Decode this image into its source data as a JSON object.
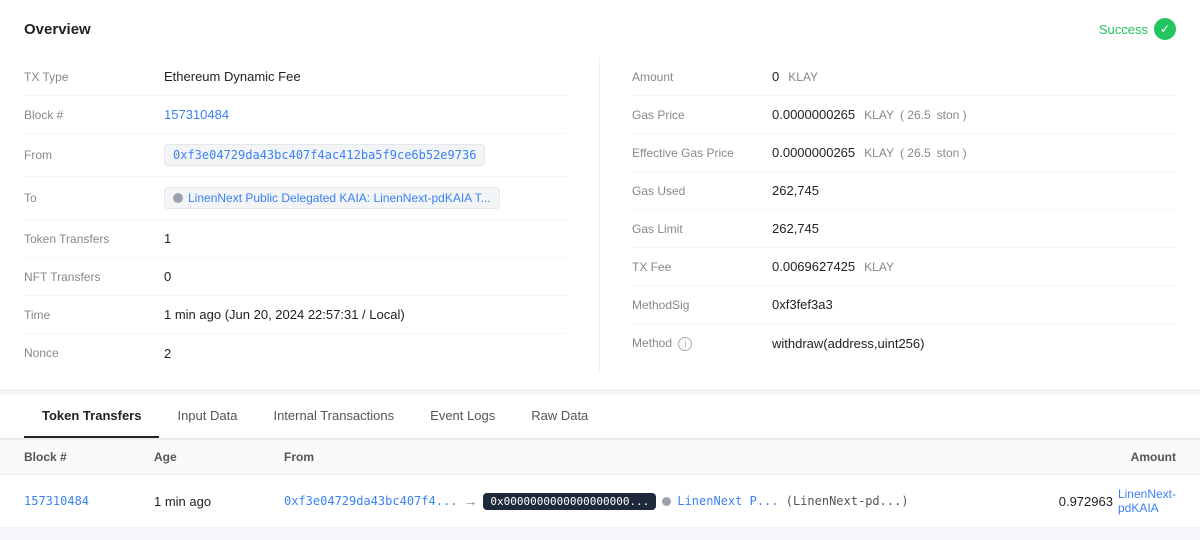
{
  "overview": {
    "title": "Overview",
    "status": "Success",
    "left": {
      "fields": [
        {
          "id": "tx-type",
          "label": "TX Type",
          "value": "Ethereum Dynamic Fee",
          "type": "text"
        },
        {
          "id": "block",
          "label": "Block #",
          "value": "157310484",
          "type": "link"
        },
        {
          "id": "from",
          "label": "From",
          "value": "0xf3e04729da43bc407f4ac412ba5f9ce6b52e9736",
          "type": "address"
        },
        {
          "id": "to",
          "label": "To",
          "value": "LinenNext Public Delegated KAIA: LinenNext-pdKAIA T...",
          "type": "to-address"
        },
        {
          "id": "token-transfers",
          "label": "Token Transfers",
          "value": "1",
          "type": "text"
        },
        {
          "id": "nft-transfers",
          "label": "NFT Transfers",
          "value": "0",
          "type": "text"
        },
        {
          "id": "time",
          "label": "Time",
          "value": "1 min ago (Jun 20, 2024 22:57:31 / Local)",
          "type": "text"
        },
        {
          "id": "nonce",
          "label": "Nonce",
          "value": "2",
          "type": "text"
        }
      ]
    },
    "right": {
      "fields": [
        {
          "id": "amount",
          "label": "Amount",
          "value": "0",
          "unit": "KLAY",
          "type": "amount"
        },
        {
          "id": "gas-price",
          "label": "Gas Price",
          "value": "0.0000000265",
          "unit": "KLAY",
          "paren": "( 26.5",
          "ston": "ston )",
          "type": "gas"
        },
        {
          "id": "effective-gas-price",
          "label": "Effective Gas Price",
          "value": "0.0000000265",
          "unit": "KLAY",
          "paren": "( 26.5",
          "ston": "ston )",
          "type": "gas"
        },
        {
          "id": "gas-used",
          "label": "Gas Used",
          "value": "262,745",
          "type": "text"
        },
        {
          "id": "gas-limit",
          "label": "Gas Limit",
          "value": "262,745",
          "type": "text"
        },
        {
          "id": "tx-fee",
          "label": "TX Fee",
          "value": "0.0069627425",
          "unit": "KLAY",
          "type": "fee"
        },
        {
          "id": "methodsig",
          "label": "MethodSig",
          "value": "0xf3fef3a3",
          "type": "text"
        },
        {
          "id": "method",
          "label": "Method",
          "value": "withdraw(address,uint256)",
          "type": "method"
        }
      ]
    }
  },
  "tabs": {
    "items": [
      {
        "id": "token-transfers",
        "label": "Token Transfers",
        "active": true
      },
      {
        "id": "input-data",
        "label": "Input Data",
        "active": false
      },
      {
        "id": "internal-transactions",
        "label": "Internal Transactions",
        "active": false
      },
      {
        "id": "event-logs",
        "label": "Event Logs",
        "active": false
      },
      {
        "id": "raw-data",
        "label": "Raw Data",
        "active": false
      }
    ]
  },
  "table": {
    "headers": [
      "Block #",
      "Age",
      "From",
      "",
      "Amount"
    ],
    "rows": [
      {
        "block": "157310484",
        "age": "1 min ago",
        "from_addr": "0xf3e04729da43bc407f4...",
        "from_tooltip": "0x0000000000000000000000000000000000000000",
        "to_highlighted": "0x0000000000000000000...",
        "to_label": "LinenNext P...",
        "to_sublabel": "(LinenNext-pd...)",
        "amount": "0.972963",
        "token": "LinenNext-pdKAIA"
      }
    ]
  }
}
